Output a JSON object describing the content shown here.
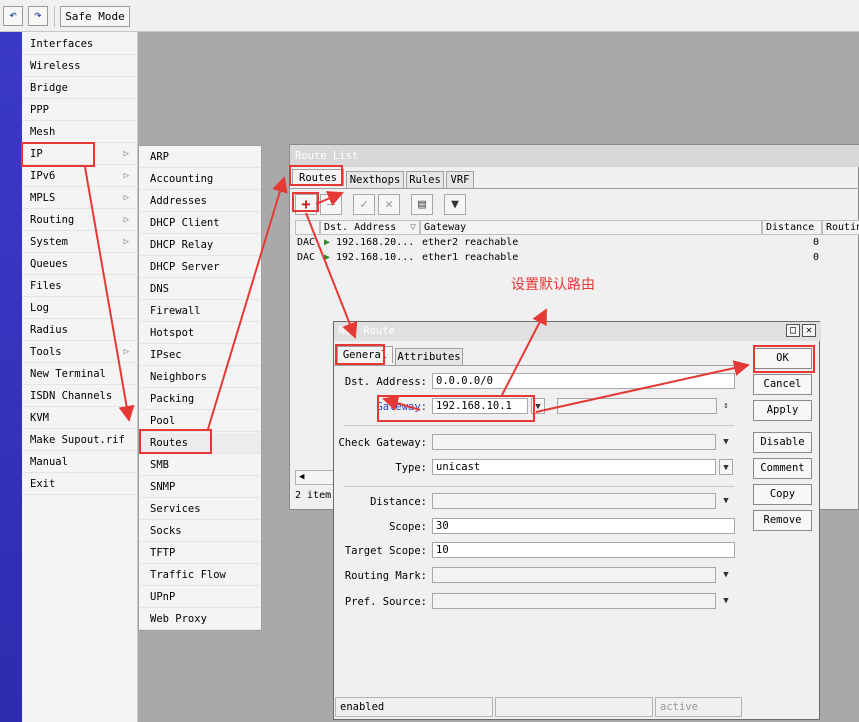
{
  "toolbar": {
    "undo_icon": "undo-icon",
    "redo_icon": "redo-icon",
    "safe_mode_label": "Safe Mode"
  },
  "menu": {
    "items": [
      {
        "label": "Interfaces"
      },
      {
        "label": "Wireless"
      },
      {
        "label": "Bridge"
      },
      {
        "label": "PPP"
      },
      {
        "label": "Mesh"
      },
      {
        "label": "IP"
      },
      {
        "label": "IPv6"
      },
      {
        "label": "MPLS"
      },
      {
        "label": "Routing"
      },
      {
        "label": "System"
      },
      {
        "label": "Queues"
      },
      {
        "label": "Files"
      },
      {
        "label": "Log"
      },
      {
        "label": "Radius"
      },
      {
        "label": "Tools"
      },
      {
        "label": "New Terminal"
      },
      {
        "label": "ISDN Channels"
      },
      {
        "label": "KVM"
      },
      {
        "label": "Make Supout.rif"
      },
      {
        "label": "Manual"
      },
      {
        "label": "Exit"
      }
    ]
  },
  "submenu": {
    "items": [
      {
        "label": "ARP"
      },
      {
        "label": "Accounting"
      },
      {
        "label": "Addresses"
      },
      {
        "label": "DHCP Client"
      },
      {
        "label": "DHCP Relay"
      },
      {
        "label": "DHCP Server"
      },
      {
        "label": "DNS"
      },
      {
        "label": "Firewall"
      },
      {
        "label": "Hotspot"
      },
      {
        "label": "IPsec"
      },
      {
        "label": "Neighbors"
      },
      {
        "label": "Packing"
      },
      {
        "label": "Pool"
      },
      {
        "label": "Routes"
      },
      {
        "label": "SMB"
      },
      {
        "label": "SNMP"
      },
      {
        "label": "Services"
      },
      {
        "label": "Socks"
      },
      {
        "label": "TFTP"
      },
      {
        "label": "Traffic Flow"
      },
      {
        "label": "UPnP"
      },
      {
        "label": "Web Proxy"
      }
    ]
  },
  "route_list": {
    "title": "Route List",
    "tabs": [
      "Routes",
      "Nexthops",
      "Rules",
      "VRF"
    ],
    "columns": {
      "dst": "Dst. Address",
      "gateway": "Gateway",
      "distance": "Distance",
      "routing": "Routin"
    },
    "rows": [
      {
        "flags": "DAC",
        "dst": "192.168.20...",
        "gateway": "ether2 reachable",
        "distance": "0"
      },
      {
        "flags": "DAC",
        "dst": "192.168.10...",
        "gateway": "ether1 reachable",
        "distance": "0"
      }
    ],
    "item_count": "2 item"
  },
  "dialog": {
    "title": "New Route",
    "tabs": [
      "General",
      "Attributes"
    ],
    "fields": {
      "dst_label": "Dst. Address:",
      "dst_value": "0.0.0.0/0",
      "gateway_label": "Gateway:",
      "gateway_value": "192.168.10.1",
      "check_gateway_label": "Check Gateway:",
      "type_label": "Type:",
      "type_value": "unicast",
      "distance_label": "Distance:",
      "scope_label": "Scope:",
      "scope_value": "30",
      "target_scope_label": "Target Scope:",
      "target_scope_value": "10",
      "routing_mark_label": "Routing Mark:",
      "pref_source_label": "Pref. Source:"
    },
    "buttons": {
      "ok": "OK",
      "cancel": "Cancel",
      "apply": "Apply",
      "disable": "Disable",
      "comment": "Comment",
      "copy": "Copy",
      "remove": "Remove"
    },
    "status": {
      "left": "enabled",
      "right": "active"
    }
  },
  "annotation": {
    "text": "设置默认路由",
    "color": "#e53935"
  }
}
